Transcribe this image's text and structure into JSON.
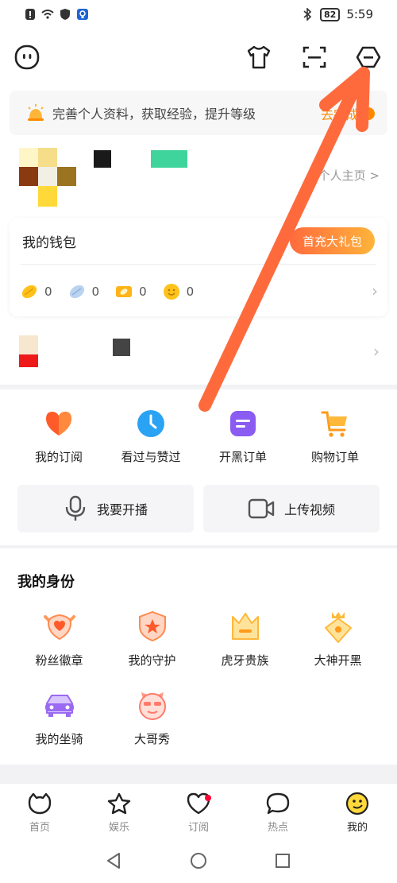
{
  "status_bar": {
    "battery": "82",
    "time": "5:59"
  },
  "banner": {
    "text": "完善个人资料，获取经验，提升等级",
    "action": "去完成"
  },
  "profile": {
    "homepage_link": "个人主页 >"
  },
  "wallet": {
    "title": "我的钱包",
    "promo_button": "首充大礼包",
    "balances": [
      {
        "icon": "gold-bean-icon",
        "value": "0"
      },
      {
        "icon": "silver-bean-icon",
        "value": "0"
      },
      {
        "icon": "coupon-icon",
        "value": "0"
      },
      {
        "icon": "smile-coin-icon",
        "value": "0"
      }
    ]
  },
  "quick_actions": [
    {
      "label": "我的订阅",
      "icon": "heart-icon"
    },
    {
      "label": "看过与赞过",
      "icon": "clock-icon"
    },
    {
      "label": "开黑订单",
      "icon": "order-icon"
    },
    {
      "label": "购物订单",
      "icon": "cart-icon"
    }
  ],
  "wide_buttons": {
    "live": "我要开播",
    "upload": "上传视频"
  },
  "identity": {
    "title": "我的身份",
    "items": [
      {
        "label": "粉丝徽章",
        "icon": "fan-badge-icon"
      },
      {
        "label": "我的守护",
        "icon": "guard-icon"
      },
      {
        "label": "虎牙贵族",
        "icon": "crown-icon"
      },
      {
        "label": "大神开黑",
        "icon": "master-icon"
      },
      {
        "label": "我的坐骑",
        "icon": "car-icon"
      },
      {
        "label": "大哥秀",
        "icon": "face-icon"
      }
    ]
  },
  "tabs": [
    {
      "label": "首页",
      "icon": "home-icon"
    },
    {
      "label": "娱乐",
      "icon": "star-icon"
    },
    {
      "label": "订阅",
      "icon": "heart-outline-icon"
    },
    {
      "label": "热点",
      "icon": "chat-icon"
    },
    {
      "label": "我的",
      "icon": "me-icon",
      "active": true
    }
  ],
  "colors": {
    "accent": "#ff8a00",
    "arrow": "#ff6a3d"
  }
}
